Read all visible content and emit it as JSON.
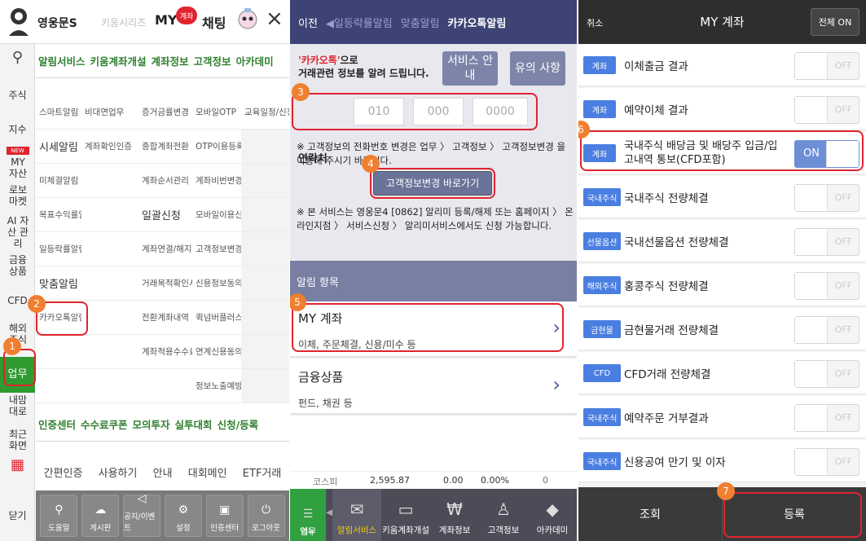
{
  "panel1": {
    "logo_name": "영웅문S",
    "topnav": [
      "키움시리즈",
      "MY",
      "채팅"
    ],
    "my_badge": "계좌",
    "close": "×",
    "sidebar": [
      "주식",
      "지수",
      "NEW",
      "MY 자산",
      "로보 마켓",
      "AI 자산 관리",
      "금융 상품",
      "CFD",
      "해외 주식",
      "업무",
      "내맘 대로",
      "최근 화면",
      "닫기"
    ],
    "tabs1": [
      "알림서비스",
      "키움계좌개설",
      "계좌정보",
      "고객정보",
      "아카데미"
    ],
    "grid": [
      [
        "스마트알림",
        "비대면업무",
        "증거금률변경",
        "모바일OTP",
        "교육일정/신청"
      ],
      [
        "시세알림",
        "계좌확인인증",
        "종합계좌전환",
        "OTP이용등록",
        ""
      ],
      [
        "미체결알림",
        "",
        "계좌순서관리",
        "계좌비번변경",
        ""
      ],
      [
        "목표수익률알림",
        "",
        "일괄신청",
        "모바일이용신청",
        ""
      ],
      [
        "일등락률알림",
        "",
        "계좌연결/해지",
        "고객정보변경",
        ""
      ],
      [
        "맞춤알림",
        "",
        "거래목적확인서",
        "신용정보동의서",
        ""
      ],
      [
        "카카오톡알림",
        "",
        "전환계좌내역",
        "퀵넘버플러스",
        ""
      ],
      [
        "",
        "",
        "계좌적용수수료",
        "연계신용동의",
        ""
      ],
      [
        "",
        "",
        "",
        "정보노출예방",
        ""
      ]
    ],
    "tabs2": [
      "인증센터",
      "수수료쿠폰",
      "모의투자",
      "실투대회",
      "신청/등록"
    ],
    "row3": [
      "간편인증",
      "사용하기",
      "안내",
      "대회메인",
      "ETF거래"
    ],
    "bottom_buttons": [
      "도움말",
      "게시판",
      "공지/이벤트",
      "설정",
      "인증센터",
      "로그아웃"
    ]
  },
  "panel2": {
    "top_back": "이전",
    "top_tabs": [
      "◀일등락률알림",
      "맞춤알림",
      "카카오톡알림"
    ],
    "kakao_word": "'카카오톡'",
    "kakao_suffix": "으로",
    "info_line2": "거래관련 정보를 알려 드립니다.",
    "service_btn": "서비스 안내",
    "notice_btn": "유의 사항",
    "contact_label": "연락처",
    "phone": [
      "010",
      "000",
      "0000"
    ],
    "note1": "※ 고객정보의 전화번호 변경은 업무 〉 고객정보 〉 고객정보변경 을 이용해 주시기 바랍니다.",
    "change_btn": "고객정보변경 바로가기",
    "note2": "※ 본 서비스는 영웅문4 [0862] 알리미 등록/해제 또는 홈페이지 〉 온라인지점 〉 서비스신청 〉 알리미서비스에서도 신청 가능합니다.",
    "section": "알림 항목",
    "items": [
      {
        "title": "MY 계좌",
        "sub": "이체, 주문체결, 신용/미수 등"
      },
      {
        "title": "금융상품",
        "sub": "펀드, 채권 등"
      }
    ],
    "ticker": {
      "name": "코스피",
      "value": "2,595.87",
      "change": "0.00",
      "pct": "0.00%",
      "vol": "0"
    },
    "nav_menu": "메뉴",
    "nav_work": "업무",
    "nav": [
      "알림서비스",
      "키움계좌개설",
      "계좌정보",
      "고객정보",
      "아카데미"
    ]
  },
  "panel3": {
    "cancel": "취소",
    "title": "MY 계좌",
    "all_on": "전체 ON",
    "rows": [
      {
        "badge": "계좌",
        "label": "이체출금 결과",
        "state": "OFF"
      },
      {
        "badge": "계좌",
        "label": "예약이체 결과",
        "state": "OFF"
      },
      {
        "badge": "계좌",
        "label": "국내주식 배당금 및 배당주 입금/입고내역 통보(CFD포함)",
        "state": "ON"
      },
      {
        "badge": "국내주식",
        "label": "국내주식 전량체결",
        "state": "OFF"
      },
      {
        "badge": "선물옵션",
        "label": "국내선물옵션 전량체결",
        "state": "OFF"
      },
      {
        "badge": "해외주식",
        "label": "홍콩주식 전량체결",
        "state": "OFF"
      },
      {
        "badge": "금현물",
        "label": "금현물거래 전량체결",
        "state": "OFF"
      },
      {
        "badge": "CFD",
        "label": "CFD거래 전량체결",
        "state": "OFF"
      },
      {
        "badge": "국내주식",
        "label": "예약주문 거부결과",
        "state": "OFF"
      },
      {
        "badge": "국내주식",
        "label": "신용공여 만기 및 이자",
        "state": "OFF"
      }
    ],
    "lookup": "조회",
    "register": "등록"
  },
  "steps": [
    "1",
    "2",
    "3",
    "4",
    "5",
    "6",
    "7"
  ]
}
